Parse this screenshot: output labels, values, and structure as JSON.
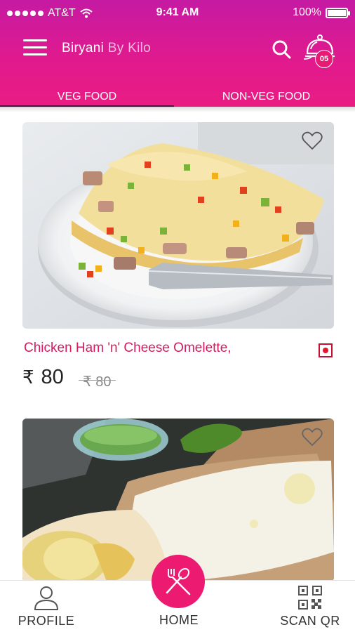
{
  "status_bar": {
    "carrier": "AT&T",
    "time": "9:41 AM",
    "battery": "100%",
    "battery_level": 1.0
  },
  "app_bar": {
    "title_main": "Biryani",
    "title_sub": "By Kilo",
    "cart_count": "05"
  },
  "tabs": [
    {
      "label": "VEG FOOD",
      "active": true
    },
    {
      "label": "NON-VEG FOOD",
      "active": false
    }
  ],
  "items": [
    {
      "name": "Chicken Ham 'n' Cheese Omelette,",
      "currency": "₹",
      "price": "80",
      "old_price": "₹ 80",
      "favorite": false
    },
    {
      "name": "",
      "favorite": false
    }
  ],
  "bottom_nav": {
    "profile": "PROFILE",
    "home": "HOME",
    "scan": "SCAN QR"
  },
  "colors": {
    "header_top": "#c51aa3",
    "header_bottom": "#ea1c83",
    "accent": "#ec1a70",
    "item_name": "#d41b60"
  }
}
